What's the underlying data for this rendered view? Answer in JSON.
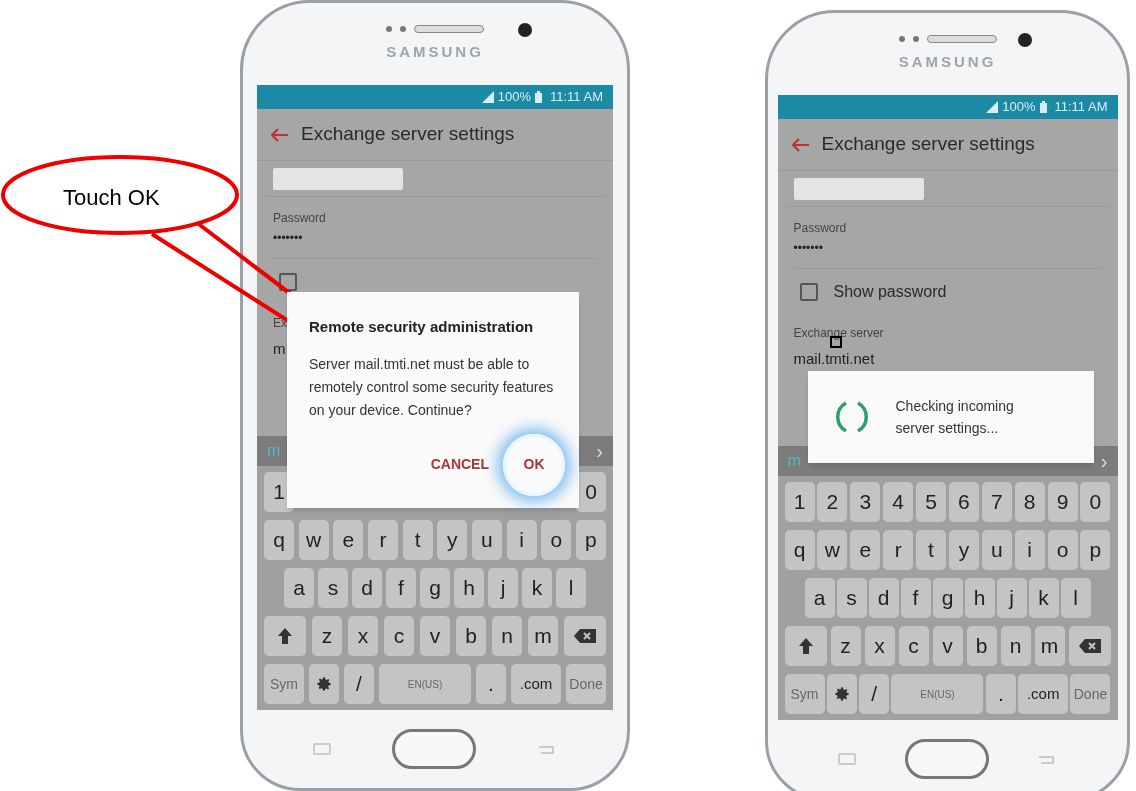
{
  "callout": {
    "text": "Touch OK"
  },
  "phones": [
    {
      "brand": "SAMSUNG",
      "status": {
        "battery": "100%",
        "time": "11:11 AM"
      },
      "title": "Exchange server settings",
      "password": {
        "label": "Password",
        "value": "•••••••"
      },
      "show_password": {
        "checked": false
      },
      "exchange_server": {
        "label": "Ex",
        "value": "m"
      },
      "suggestion": {
        "text": "m",
        "arrow": "›"
      },
      "dialog": {
        "kind": "confirm",
        "title": "Remote security administration",
        "message": "Server mail.tmti.net must be able to remotely control some security features on your device. Continue?",
        "buttons": [
          {
            "label": "CANCEL",
            "touched": false
          },
          {
            "label": "OK",
            "touched": true
          }
        ]
      },
      "keyboard": [
        {
          "keys": [
            {
              "kind": "char",
              "label": "1"
            },
            {
              "kind": "char",
              "label": "0"
            }
          ]
        },
        {
          "keys": [
            {
              "kind": "char",
              "label": "q"
            },
            {
              "kind": "char",
              "label": "w"
            },
            {
              "kind": "char",
              "label": "e"
            },
            {
              "kind": "char",
              "label": "r"
            },
            {
              "kind": "char",
              "label": "t"
            },
            {
              "kind": "char",
              "label": "y"
            },
            {
              "kind": "char",
              "label": "u"
            },
            {
              "kind": "char",
              "label": "i"
            },
            {
              "kind": "char",
              "label": "o"
            },
            {
              "kind": "char",
              "label": "p"
            }
          ]
        },
        {
          "indent": true,
          "keys": [
            {
              "kind": "char",
              "label": "a"
            },
            {
              "kind": "char",
              "label": "s"
            },
            {
              "kind": "char",
              "label": "d"
            },
            {
              "kind": "char",
              "label": "f"
            },
            {
              "kind": "char",
              "label": "g"
            },
            {
              "kind": "char",
              "label": "h"
            },
            {
              "kind": "char",
              "label": "j"
            },
            {
              "kind": "char",
              "label": "k"
            },
            {
              "kind": "char",
              "label": "l"
            }
          ]
        },
        {
          "keys": [
            {
              "kind": "shift"
            },
            {
              "kind": "char",
              "label": "z"
            },
            {
              "kind": "char",
              "label": "x"
            },
            {
              "kind": "char",
              "label": "c"
            },
            {
              "kind": "char",
              "label": "v"
            },
            {
              "kind": "char",
              "label": "b"
            },
            {
              "kind": "char",
              "label": "n"
            },
            {
              "kind": "char",
              "label": "m"
            },
            {
              "kind": "backspace"
            }
          ]
        },
        {
          "keys": [
            {
              "kind": "fn",
              "label": "Sym"
            },
            {
              "kind": "settings"
            },
            {
              "kind": "char",
              "label": "/"
            },
            {
              "kind": "space",
              "label": "EN(US)"
            },
            {
              "kind": "char",
              "label": "."
            },
            {
              "kind": "wide",
              "label": ".com"
            },
            {
              "kind": "fn",
              "label": "Done"
            }
          ]
        }
      ]
    },
    {
      "brand": "SAMSUNG",
      "status": {
        "battery": "100%",
        "time": "11:11 AM"
      },
      "title": "Exchange server settings",
      "password": {
        "label": "Password",
        "value": "•••••••"
      },
      "show_password": {
        "checked": false,
        "label": "Show password"
      },
      "exchange_server": {
        "label": "Exchange server",
        "value": "mail.tmti.net"
      },
      "suggestion": {
        "text": "m",
        "arrow": "›"
      },
      "dialog": {
        "kind": "progress",
        "message": "Checking incoming server settings..."
      },
      "keyboard": [
        {
          "keys": [
            {
              "kind": "char",
              "label": "1"
            },
            {
              "kind": "char",
              "label": "2"
            },
            {
              "kind": "char",
              "label": "3"
            },
            {
              "kind": "char",
              "label": "4"
            },
            {
              "kind": "char",
              "label": "5"
            },
            {
              "kind": "char",
              "label": "6"
            },
            {
              "kind": "char",
              "label": "7"
            },
            {
              "kind": "char",
              "label": "8"
            },
            {
              "kind": "char",
              "label": "9"
            },
            {
              "kind": "char",
              "label": "0"
            }
          ]
        },
        {
          "keys": [
            {
              "kind": "char",
              "label": "q"
            },
            {
              "kind": "char",
              "label": "w"
            },
            {
              "kind": "char",
              "label": "e"
            },
            {
              "kind": "char",
              "label": "r"
            },
            {
              "kind": "char",
              "label": "t"
            },
            {
              "kind": "char",
              "label": "y"
            },
            {
              "kind": "char",
              "label": "u"
            },
            {
              "kind": "char",
              "label": "i"
            },
            {
              "kind": "char",
              "label": "o"
            },
            {
              "kind": "char",
              "label": "p"
            }
          ]
        },
        {
          "indent": true,
          "keys": [
            {
              "kind": "char",
              "label": "a"
            },
            {
              "kind": "char",
              "label": "s"
            },
            {
              "kind": "char",
              "label": "d"
            },
            {
              "kind": "char",
              "label": "f"
            },
            {
              "kind": "char",
              "label": "g"
            },
            {
              "kind": "char",
              "label": "h"
            },
            {
              "kind": "char",
              "label": "j"
            },
            {
              "kind": "char",
              "label": "k"
            },
            {
              "kind": "char",
              "label": "l"
            }
          ]
        },
        {
          "keys": [
            {
              "kind": "shift"
            },
            {
              "kind": "char",
              "label": "z"
            },
            {
              "kind": "char",
              "label": "x"
            },
            {
              "kind": "char",
              "label": "c"
            },
            {
              "kind": "char",
              "label": "v"
            },
            {
              "kind": "char",
              "label": "b"
            },
            {
              "kind": "char",
              "label": "n"
            },
            {
              "kind": "char",
              "label": "m"
            },
            {
              "kind": "backspace"
            }
          ]
        },
        {
          "keys": [
            {
              "kind": "fn",
              "label": "Sym"
            },
            {
              "kind": "settings"
            },
            {
              "kind": "char",
              "label": "/"
            },
            {
              "kind": "space",
              "label": "EN(US)"
            },
            {
              "kind": "char",
              "label": "."
            },
            {
              "kind": "wide",
              "label": ".com"
            },
            {
              "kind": "fn",
              "label": "Done"
            }
          ]
        }
      ]
    }
  ]
}
